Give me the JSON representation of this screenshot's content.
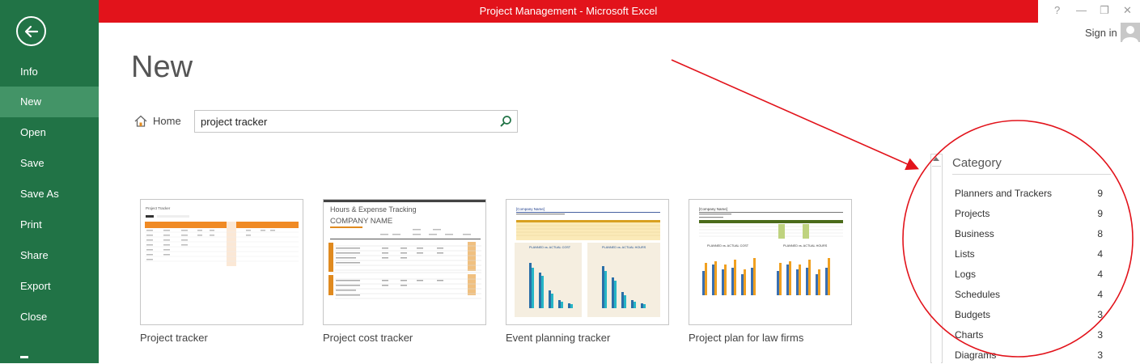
{
  "window": {
    "title": "Project Management -  Microsoft Excel",
    "help": "?",
    "minimize": "—",
    "restore": "❐",
    "close": "✕",
    "sign_in": "Sign in"
  },
  "sidebar": {
    "items": [
      {
        "label": "Info",
        "active": false
      },
      {
        "label": "New",
        "active": true
      },
      {
        "label": "Open",
        "active": false
      },
      {
        "label": "Save",
        "active": false
      },
      {
        "label": "Save As",
        "active": false
      },
      {
        "label": "Print",
        "active": false
      },
      {
        "label": "Share",
        "active": false
      },
      {
        "label": "Export",
        "active": false
      },
      {
        "label": "Close",
        "active": false
      }
    ]
  },
  "main": {
    "title": "New",
    "home_label": "Home",
    "search": {
      "value": "project tracker"
    }
  },
  "templates": [
    {
      "label": "Project tracker",
      "thumb_title": "Project Tracker"
    },
    {
      "label": "Project cost tracker",
      "thumb_title": "Hours & Expense Tracking",
      "thumb_company": "COMPANY NAME"
    },
    {
      "label": "Event planning tracker",
      "thumb_title": "[Company Name]",
      "chart_a": "PLANNED vs. ACTUAL COST",
      "chart_b": "PLANNED vs. ACTUAL HOURS"
    },
    {
      "label": "Project plan for law firms",
      "thumb_title": "[Company Name]",
      "chart_a": "PLANNED vs. ACTUAL COST",
      "chart_b": "PLANNED vs. ACTUAL HOURS"
    }
  ],
  "category": {
    "title": "Category",
    "items": [
      {
        "label": "Planners and Trackers",
        "count": "9"
      },
      {
        "label": "Projects",
        "count": "9"
      },
      {
        "label": "Business",
        "count": "8"
      },
      {
        "label": "Lists",
        "count": "4"
      },
      {
        "label": "Logs",
        "count": "4"
      },
      {
        "label": "Schedules",
        "count": "4"
      },
      {
        "label": "Budgets",
        "count": "3"
      },
      {
        "label": "Charts",
        "count": "3"
      },
      {
        "label": "Diagrams",
        "count": "3"
      }
    ]
  },
  "colors": {
    "sidebar": "#217346",
    "sidebar_active": "#439467",
    "titlebar": "#e2131b",
    "annotation": "#e2131b"
  }
}
